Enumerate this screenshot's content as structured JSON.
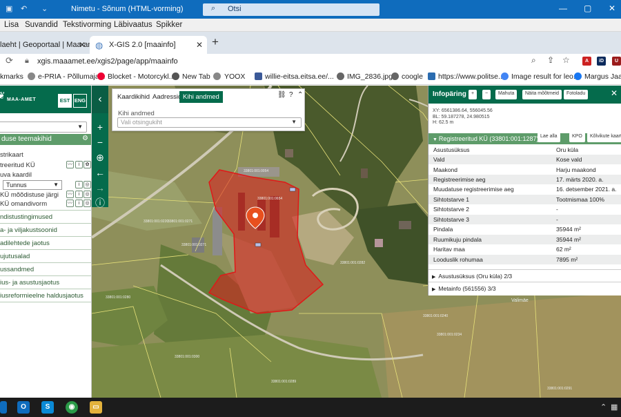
{
  "outlook": {
    "title": "Nimetu - Sõnum (HTML-vorming)",
    "search_placeholder": "Otsi",
    "menu": [
      "Lisa",
      "Suvandid",
      "Tekstivorming",
      "Läbivaatus",
      "Spikker"
    ]
  },
  "browser": {
    "tabs": [
      {
        "label": "laeht | Geoportaal | Maa-amet"
      },
      {
        "label": "X-GIS 2.0 [maainfo]"
      }
    ],
    "url": "xgis.maaamet.ee/xgis2/page/app/maainfo",
    "bookmarks": [
      "kmarks",
      "e-PRIA - Põllumaja...",
      "Blocket - Motorcykl...",
      "New Tab",
      "YOOX",
      "willie-eitsa.eitsa.ee/...",
      "IMG_2836.jpg",
      "coogle",
      "https://www.politse...",
      "Image result for leo...",
      "Margus Jaansc"
    ]
  },
  "left": {
    "org": "MAA-AMET",
    "lang": [
      "EST",
      "ENG"
    ],
    "section_title": "duse teemakihid",
    "items": [
      "strikaart",
      "treeritud KÜ",
      "uva kaardil",
      "KÜ mõõdistuse järgi",
      "KÜ omandivorm"
    ],
    "tunnus": "Tunnus",
    "sections": [
      "ndistustingimused",
      "a- ja viljakustsoonid",
      "adilehtede jaotus",
      "ujutusalad",
      "ussandmed",
      "ius- ja asustusjaotus",
      "iusreformieelne haldusjaotus"
    ]
  },
  "layers": {
    "tabs": [
      "Kaardikihid",
      "Aadressid",
      "Kihi andmed"
    ],
    "label": "Kihi andmed",
    "placeholder": "Vali otsingukiht"
  },
  "info": {
    "title": "Infopäring",
    "buttons": [
      "+",
      "−",
      "Mahuta",
      "Näita mõõtmeid",
      "Fotoladu"
    ],
    "coords": [
      "XY: 6561386.64, 556045.56",
      "BL: 59.187278, 24.980515",
      "H: 62.5 m"
    ],
    "reg_title": "Registreeritud KÜ (33801:001:1287) 1/3",
    "reg_buttons": [
      "Lae alla",
      "KPO",
      "Kõlvikute kaart"
    ],
    "rows": [
      {
        "k": "Asustusüksus",
        "v": "Oru küla"
      },
      {
        "k": "Vald",
        "v": "Kose vald"
      },
      {
        "k": "Maakond",
        "v": "Harju maakond"
      },
      {
        "k": "Registreerimise aeg",
        "v": "17. märts 2020. a."
      },
      {
        "k": "Muudatuse registreerimise aeg",
        "v": "16. detsember 2021. a."
      },
      {
        "k": "Sihtotstarve 1",
        "v": "Tootmismaa 100%"
      },
      {
        "k": "Sihtotstarve 2",
        "v": "-"
      },
      {
        "k": "Sihtotstarve 3",
        "v": "-"
      },
      {
        "k": "Pindala",
        "v": "35944 m²"
      },
      {
        "k": "Ruumikuju pindala",
        "v": "35944 m²"
      },
      {
        "k": "Haritav maa",
        "v": "62 m²"
      },
      {
        "k": "Looduslik rohumaa",
        "v": "7895 m²"
      }
    ],
    "expanders": [
      "Asustusüksus (Oru küla) 2/3",
      "Metainfo (561556) 3/3"
    ]
  },
  "map": {
    "place_label": "Valimäe"
  }
}
